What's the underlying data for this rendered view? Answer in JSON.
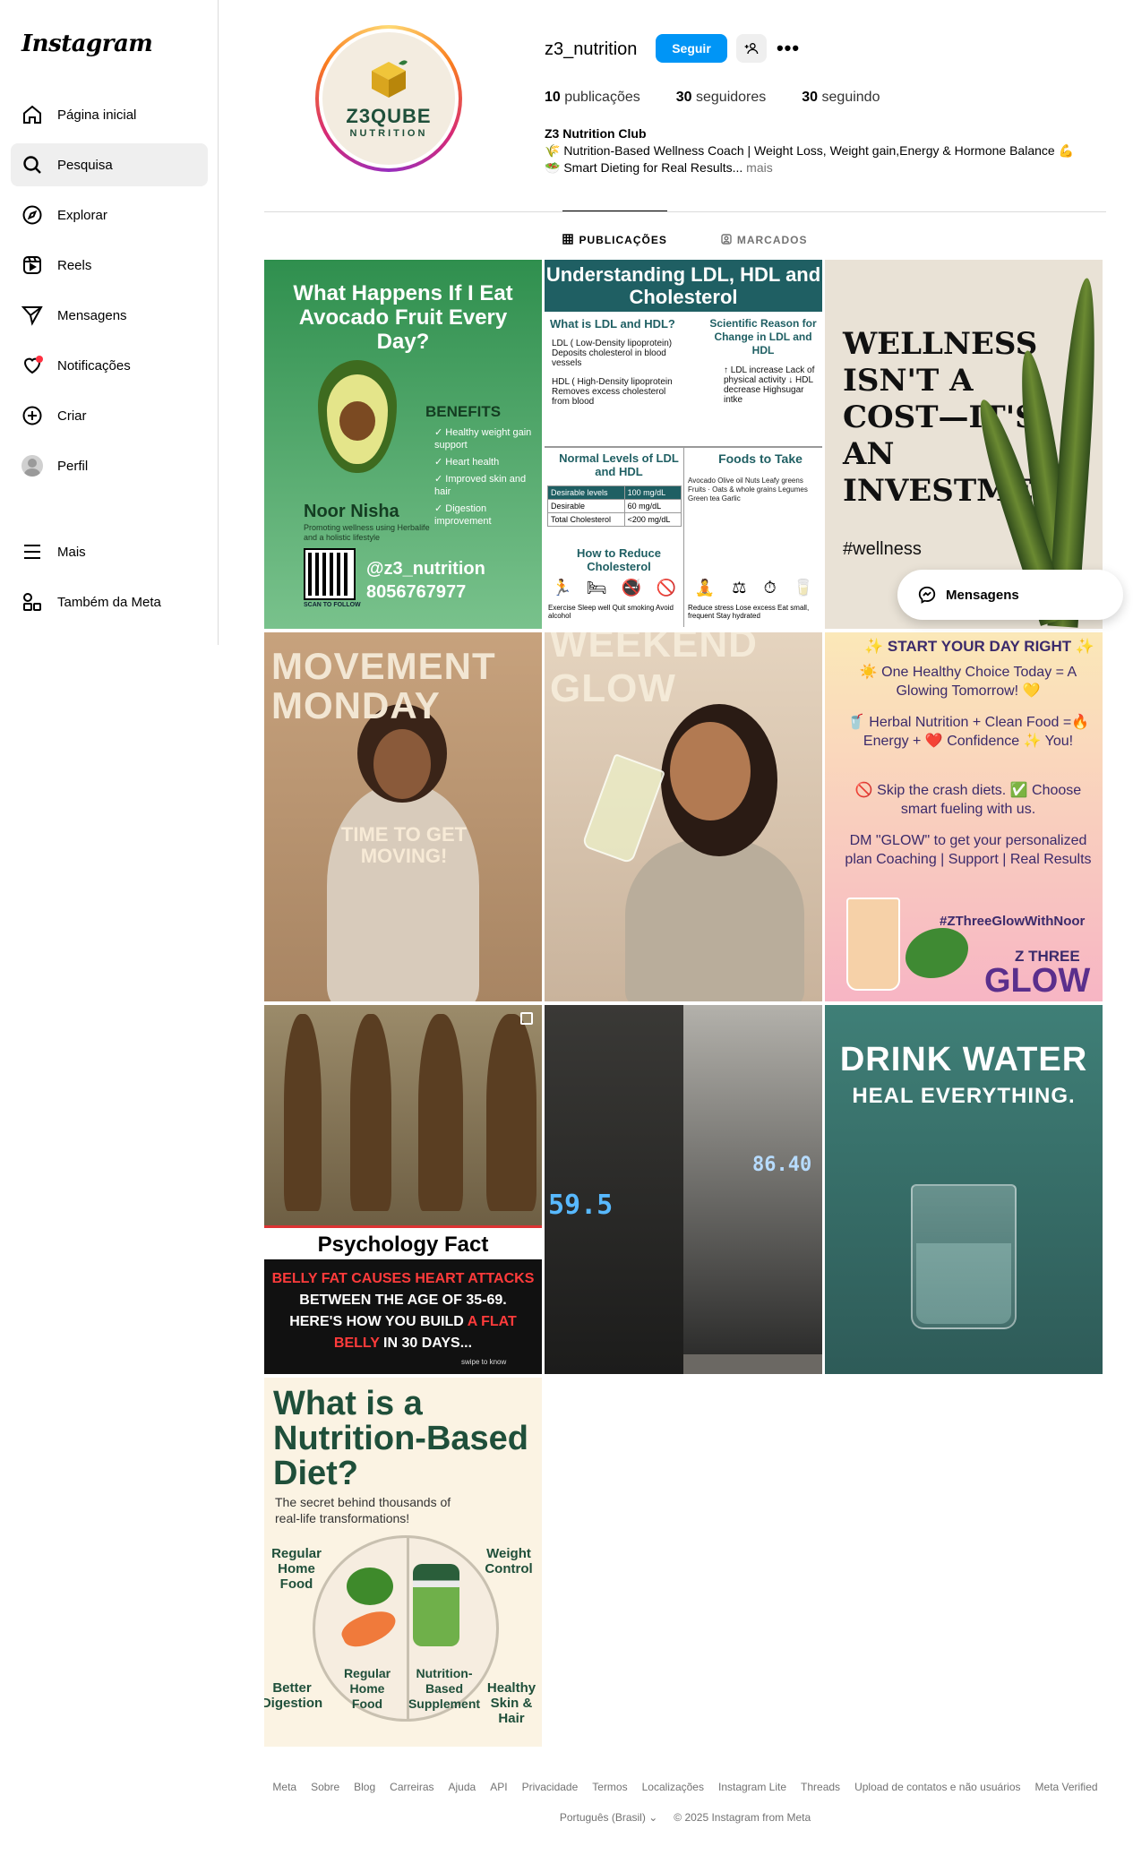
{
  "app": {
    "logo": "Instagram"
  },
  "sidebar": {
    "items": [
      {
        "label": "Página inicial",
        "icon": "home-icon"
      },
      {
        "label": "Pesquisa",
        "icon": "search-icon",
        "active": true
      },
      {
        "label": "Explorar",
        "icon": "compass-icon"
      },
      {
        "label": "Reels",
        "icon": "reels-icon"
      },
      {
        "label": "Mensagens",
        "icon": "send-icon"
      },
      {
        "label": "Notificações",
        "icon": "heart-icon"
      },
      {
        "label": "Criar",
        "icon": "plus-square-icon"
      },
      {
        "label": "Perfil",
        "icon": "avatar"
      }
    ],
    "bottom": [
      {
        "label": "Mais",
        "icon": "menu-icon"
      },
      {
        "label": "Também da Meta",
        "icon": "meta-apps-icon"
      }
    ]
  },
  "profile": {
    "avatar_brand": "Z3QUBE",
    "avatar_sub": "NUTRITION",
    "username": "z3_nutrition",
    "follow_label": "Seguir",
    "stats": {
      "posts_count": "10",
      "posts_label": "publicações",
      "followers_count": "30",
      "followers_label": "seguidores",
      "following_count": "30",
      "following_label": "seguindo"
    },
    "bio": {
      "name": "Z3 Nutrition Club",
      "line1": "🌾 Nutrition-Based Wellness Coach | Weight Loss, Weight gain,Energy & Hormone Balance 💪",
      "line2": "🥗 Smart Dieting for Real Results...",
      "more": "mais"
    }
  },
  "tabs": [
    {
      "label": "PUBLICAÇÕES",
      "active": true
    },
    {
      "label": "MARCADOS",
      "active": false
    }
  ],
  "posts": {
    "p1": {
      "title": "What Happens If I Eat Avocado Fruit Every Day?",
      "benefits_title": "BENEFITS",
      "benefits": [
        "✓ Healthy weight gain support",
        "✓ Heart health",
        "✓ Improved skin and hair",
        "✓ Digestion improvement"
      ],
      "name": "Noor Nisha",
      "name_sub": "Promoting wellness using Herbalife and a holistic lifestyle",
      "scan": "SCAN TO FOLLOW",
      "handle": "@z3_nutrition",
      "phone": "8056767977"
    },
    "p2": {
      "title": "Understanding LDL, HDL and Cholesterol",
      "q1": "What is LDL and HDL?",
      "q2": "Scientific Reason for Change in LDL and HDL",
      "ldl": "LDL ( Low-Density lipoprotein) Deposits cholesterol in blood vessels",
      "hdl": "HDL ( High-Density lipoprotein Removes excess cholesterol from blood",
      "change": "↑ LDL increase Lack of physical activity ↓ HDL decrease Highsugar intke",
      "normal": "Normal Levels of LDL and HDL",
      "foods_title": "Foods to Take",
      "table": [
        [
          "Desirable levels",
          "100 mg/dL"
        ],
        [
          "Desirable",
          "60 mg/dL"
        ],
        [
          "Total Cholesterol",
          "<200 mg/dL"
        ]
      ],
      "foods": "Avocado Olive oil Nuts Leafy greens Fruits · Oats & whole grains Legumes Green tea Garlic",
      "reduce": "How to Reduce Cholesterol",
      "reduce_items": "Exercise Sleep well Quit smoking Avoid alcohol",
      "reduce_items2": "Reduce stress Lose excess Eat small, frequent Stay hydrated"
    },
    "p3": {
      "title": "WELLNESS ISN'T A COST—IT'S AN INVESTMENT",
      "tag": "#wellness"
    },
    "p4": {
      "title": "MOVEMENT MONDAY",
      "sub": "TIME TO GET MOVING!"
    },
    "p5": {
      "title": "WEEKEND GLOW"
    },
    "p6": {
      "title": "✨ START YOUR DAY RIGHT ✨",
      "l1": "☀️ One Healthy Choice Today = A Glowing Tomorrow! 💛",
      "l2": "🥤 Herbal Nutrition + Clean Food =🔥 Energy + ❤️ Confidence ✨ You!",
      "l3": "🚫 Skip the crash diets. ✅ Choose smart fueling with us.",
      "l4": "DM \"GLOW\" to get your personalized plan Coaching | Support | Real Results",
      "hash": "#ZThreeGlowWithNoor",
      "z": "Z THREE",
      "glow": "GLOW"
    },
    "p7": {
      "strip": "Psychology Fact",
      "l1a": "BELLY FAT CAUSES HEART ATTACKS",
      "l2": "BETWEEN THE AGE OF 35-69.",
      "l3a": "HERE'S HOW YOU BUILD ",
      "l3b": "A FLAT",
      "l4a": "BELLY",
      "l4b": " IN 30 DAYS...",
      "swipe": "swipe to know"
    },
    "p8": {
      "reading1": "59.5",
      "reading2": "86.40"
    },
    "p9": {
      "title": "DRINK WATER",
      "sub": "HEAL EVERYTHING."
    },
    "p10": {
      "title": "What is a Nutrition-Based Diet?",
      "sub": "The secret behind thousands of real-life transformations!",
      "tl": "Regular Home Food",
      "tr": "Weight Control",
      "bl": "Better Digestion",
      "br": "Healthy Skin & Hair",
      "c1": "Regular Home Food",
      "c2": "Nutrition-Based Supplement"
    }
  },
  "messages_pill": "Mensagens",
  "footer": {
    "links": [
      "Meta",
      "Sobre",
      "Blog",
      "Carreiras",
      "Ajuda",
      "API",
      "Privacidade",
      "Termos",
      "Localizações",
      "Instagram Lite",
      "Threads",
      "Upload de contatos e não usuários",
      "Meta Verified"
    ],
    "language": "Português (Brasil)",
    "copyright": "© 2025 Instagram from Meta"
  }
}
